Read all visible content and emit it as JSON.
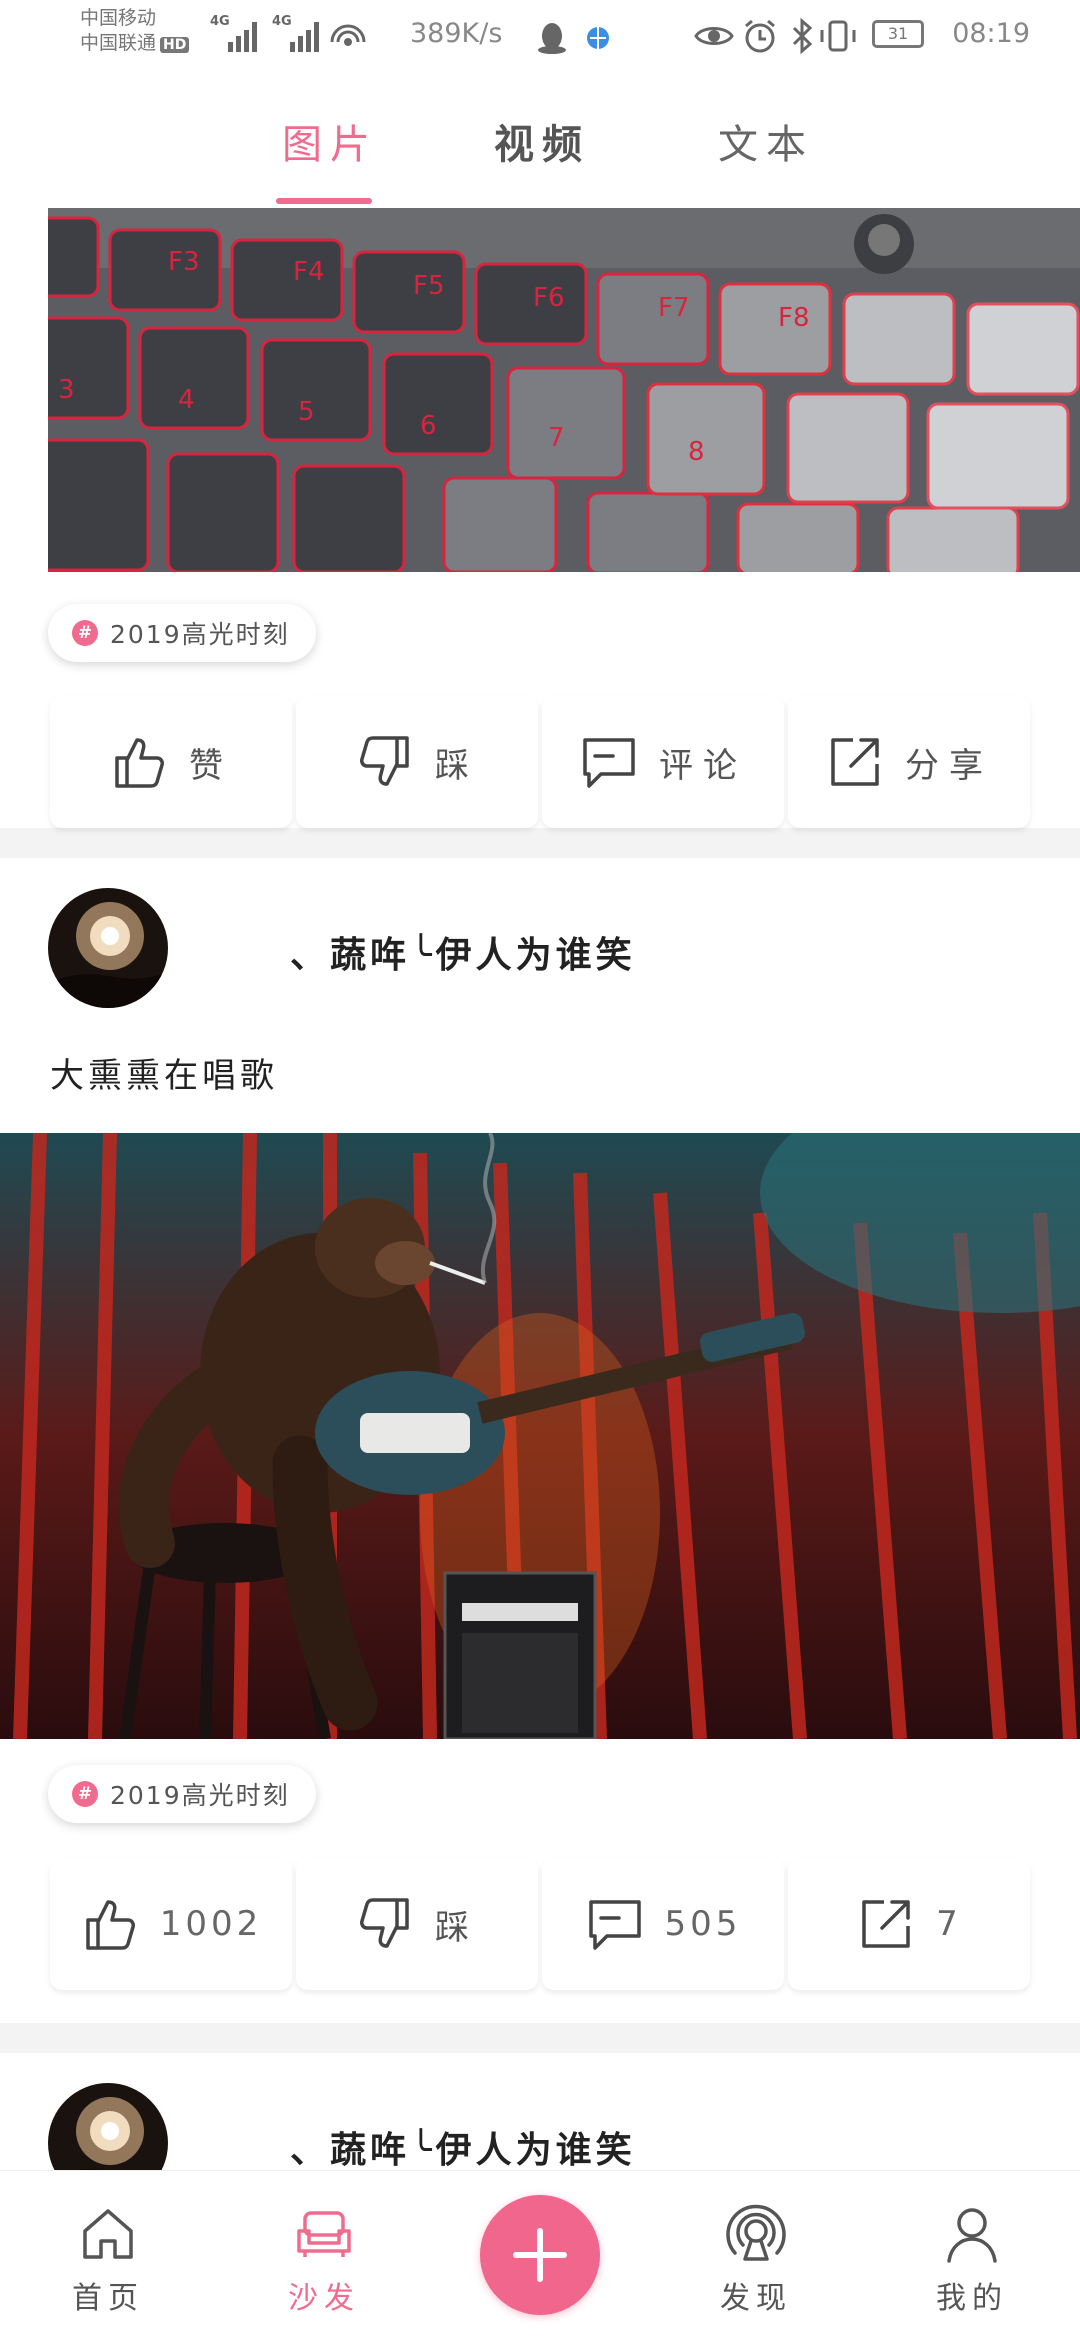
{
  "status_bar": {
    "carrier_1": "中国移动",
    "carrier_2": "中国联通",
    "hd_badge": "HD",
    "signal_1_label": "4G",
    "signal_2_label": "4G",
    "net_speed": "389K/s",
    "battery": "31",
    "time": "08:19"
  },
  "tabs": [
    {
      "label": "图片"
    },
    {
      "label": "视频"
    },
    {
      "label": "文本"
    }
  ],
  "posts": [
    {
      "topic": "2019高光时刻",
      "actions": {
        "like": "赞",
        "dislike": "踩",
        "comment": "评论",
        "share": "分享"
      }
    },
    {
      "username": "、蔬哖╰伊人为谁笑",
      "text": "大熏熏在唱歌",
      "topic": "2019高光时刻",
      "actions": {
        "like": "1002",
        "dislike": "踩",
        "comment": "505",
        "share": "7"
      }
    },
    {
      "username": "、蔬哖╰伊人为谁笑"
    }
  ],
  "bottom_nav": [
    {
      "label": "首页",
      "icon": "home-icon"
    },
    {
      "label": "沙发",
      "icon": "sofa-icon"
    },
    {
      "label": "",
      "icon": "plus-icon"
    },
    {
      "label": "发现",
      "icon": "broadcast-icon"
    },
    {
      "label": "我的",
      "icon": "user-icon"
    }
  ],
  "colors": {
    "accent": "#ef6c8f",
    "text": "#222222",
    "muted": "#555555",
    "divider": "#f3f3f3"
  }
}
